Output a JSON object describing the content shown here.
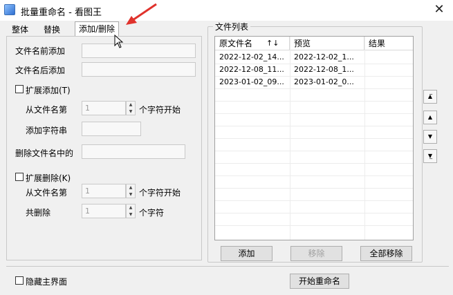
{
  "window": {
    "title": "批量重命名 - 看图王",
    "close_glyph": "✕"
  },
  "tabs": [
    {
      "label": "整体"
    },
    {
      "label": "替换"
    },
    {
      "label": "添加/删除",
      "active": true
    }
  ],
  "add_delete": {
    "prefix_label": "文件名前添加",
    "suffix_label": "文件名后添加",
    "extend_add_label": "扩展添加(T)",
    "from_name_label": "从文件名第",
    "from_value": "1",
    "char_start_label": "个字符开始",
    "add_string_label": "添加字符串",
    "delete_in_name_label": "删除文件名中的",
    "extend_delete_label": "扩展删除(K)",
    "from_name_label2": "从文件名第",
    "from_value2": "1",
    "char_start_label2": "个字符开始",
    "total_delete_label": "共删除",
    "total_value": "1",
    "char_label": "个字符"
  },
  "file_list": {
    "group_title": "文件列表",
    "columns": [
      "原文件名",
      "预览",
      "结果"
    ],
    "sort_glyph": "↑↓",
    "rows": [
      [
        "2022-12-02_14...",
        "2022-12-02_1...",
        ""
      ],
      [
        "2022-12-08_11...",
        "2022-12-08_1...",
        ""
      ],
      [
        "2023-01-02_09...",
        "2023-01-02_0...",
        ""
      ]
    ],
    "add_button": "添加",
    "remove_button": "移除",
    "remove_all_button": "全部移除"
  },
  "side_buttons": [
    "move-top",
    "move-up",
    "move-down",
    "move-bottom"
  ],
  "footer": {
    "hide_main_label": "隐藏主界面",
    "start_button": "开始重命名"
  },
  "colors": {
    "accent_arrow": "#e0322c"
  }
}
